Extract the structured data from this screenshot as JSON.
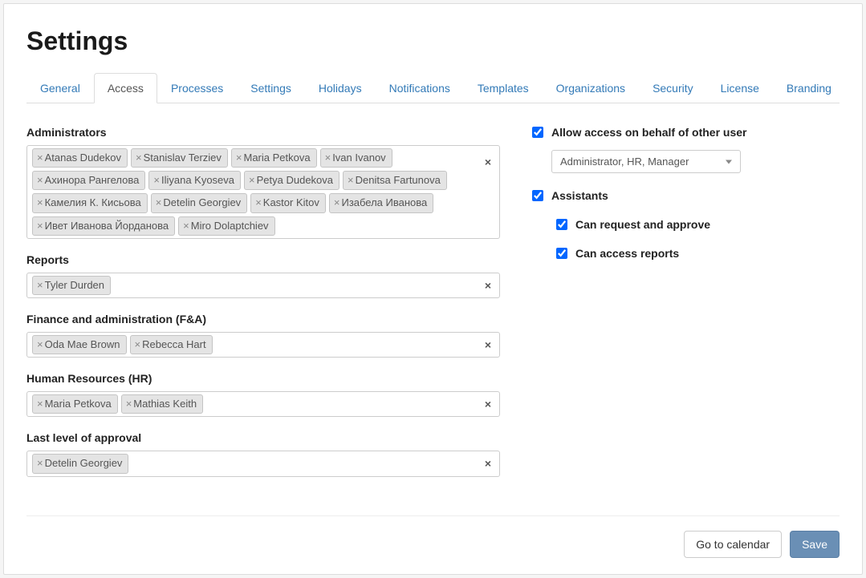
{
  "page": {
    "title": "Settings"
  },
  "tabs": [
    {
      "label": "General",
      "active": false
    },
    {
      "label": "Access",
      "active": true
    },
    {
      "label": "Processes",
      "active": false
    },
    {
      "label": "Settings",
      "active": false
    },
    {
      "label": "Holidays",
      "active": false
    },
    {
      "label": "Notifications",
      "active": false
    },
    {
      "label": "Templates",
      "active": false
    },
    {
      "label": "Organizations",
      "active": false
    },
    {
      "label": "Security",
      "active": false
    },
    {
      "label": "License",
      "active": false
    },
    {
      "label": "Branding",
      "active": false
    }
  ],
  "fields": {
    "administrators": {
      "label": "Administrators",
      "tags": [
        "Atanas Dudekov",
        "Stanislav Terziev",
        "Maria Petkova",
        "Ivan Ivanov",
        "Ахинора Рангелова",
        "Iliyana Kyoseva",
        "Petya Dudekova",
        "Denitsa Fartunova",
        "Камелия К. Кисьова",
        "Detelin Georgiev",
        "Kastor Kitov",
        "Изабела Иванова",
        "Ивет Иванова Йорданова",
        "Miro Dolaptchiev"
      ]
    },
    "reports": {
      "label": "Reports",
      "tags": [
        "Tyler Durden"
      ]
    },
    "finance": {
      "label": "Finance and administration (F&A)",
      "tags": [
        "Oda Mae Brown",
        "Rebecca Hart"
      ]
    },
    "hr": {
      "label": "Human Resources (HR)",
      "tags": [
        "Maria Petkova",
        "Mathias Keith"
      ]
    },
    "approval": {
      "label": "Last level of approval",
      "tags": [
        "Detelin Georgiev"
      ]
    }
  },
  "right": {
    "allow_behalf": {
      "label": "Allow access on behalf of other user",
      "checked": true,
      "select_value": "Administrator, HR, Manager"
    },
    "assistants": {
      "label": "Assistants",
      "checked": true
    },
    "can_request": {
      "label": "Can request and approve",
      "checked": true
    },
    "can_reports": {
      "label": "Can access reports",
      "checked": true
    }
  },
  "footer": {
    "calendar_label": "Go to calendar",
    "save_label": "Save"
  }
}
